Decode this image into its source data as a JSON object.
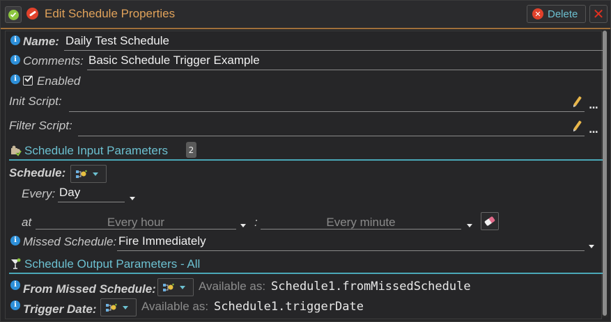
{
  "window": {
    "title": "Edit Schedule Properties",
    "delete_label": "Delete",
    "close_glyph": "✕"
  },
  "icons": {
    "ok": "check-circle-icon",
    "no": "no-entry-icon",
    "info": "info-icon",
    "checkbox": "checkbox-checked-icon",
    "pencil": "pencil-icon",
    "schedule": "schedule-tree-icon",
    "eraser": "eraser-icon",
    "input_params": "puzzle-piece-icon",
    "output_params": "cocktail-icon"
  },
  "colors": {
    "accent": "#6cc0d0",
    "title": "#e0a25a",
    "info": "#2d8fd8",
    "danger": "#e0412b"
  },
  "fields": {
    "name": {
      "label": "Name:",
      "value": "Daily Test Schedule"
    },
    "comments": {
      "label": "Comments:",
      "value": "Basic Schedule Trigger Example"
    },
    "enabled": {
      "label": "Enabled",
      "checked": true
    },
    "init_script": {
      "label": "Init Script:",
      "value": ""
    },
    "filter_script": {
      "label": "Filter Script:",
      "value": ""
    }
  },
  "input_section": {
    "title": "Schedule Input Parameters",
    "count": "2",
    "schedule_label": "Schedule:",
    "every_label": "Every:",
    "every_value": "Day",
    "at_label": "at",
    "hour_placeholder": "Every hour",
    "colon": ":",
    "minute_placeholder": "Every minute",
    "missed_label": "Missed Schedule:",
    "missed_value": "Fire Immediately"
  },
  "output_section": {
    "title": "Schedule Output Parameters - All",
    "from_missed_label": "From Missed Schedule:",
    "from_missed_prefix": "Available as:",
    "from_missed_var": "Schedule1.fromMissedSchedule",
    "trigger_label": "Trigger Date:",
    "trigger_prefix": "Available as:",
    "trigger_var": "Schedule1.triggerDate"
  },
  "misc": {
    "more": "..."
  }
}
